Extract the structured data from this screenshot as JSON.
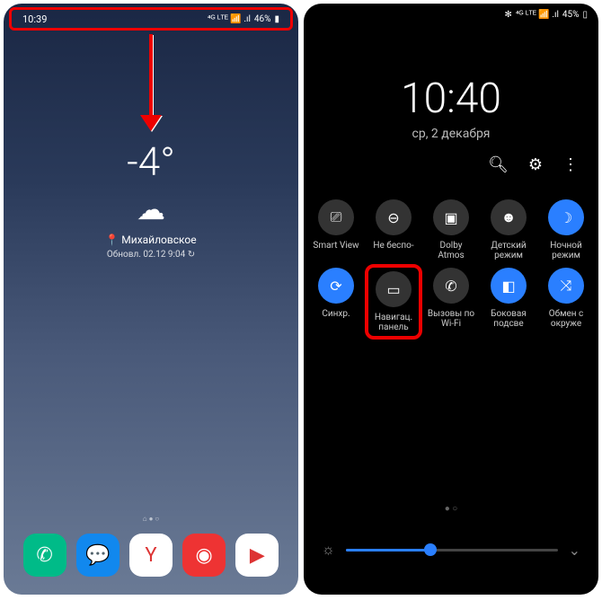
{
  "left": {
    "status": {
      "time": "10:39",
      "battery": "46%",
      "icons": "⁴ᴳ ᴸᵀᴱ 📶 .ıl"
    },
    "weather": {
      "temp": "-4°",
      "location": "Михайловское",
      "updated": "Обновл. 02.12 9:04 ↻"
    },
    "dock": [
      {
        "name": "phone",
        "glyph": "✆",
        "bg": "#0b8"
      },
      {
        "name": "messages",
        "glyph": "💬",
        "bg": "#18e"
      },
      {
        "name": "yandex",
        "glyph": "Y",
        "bg": "#fff"
      },
      {
        "name": "camera",
        "glyph": "◉",
        "bg": "#e33"
      },
      {
        "name": "play",
        "glyph": "▶",
        "bg": "#fff"
      }
    ]
  },
  "right": {
    "status": {
      "battery": "45%",
      "icons": "⁴ᴳ ᴸᵀᴱ 📶 .ıl"
    },
    "time": "10:40",
    "date": "ср, 2 декабря",
    "tiles": [
      {
        "name": "smart-view",
        "label": "Smart View",
        "glyph": "⎚",
        "active": false
      },
      {
        "name": "no-disturb",
        "label": "Не беспо-",
        "glyph": "⊖",
        "active": false
      },
      {
        "name": "dolby",
        "label": "Dolby Atmos",
        "glyph": "▣",
        "active": false
      },
      {
        "name": "kids",
        "label": "Детский режим",
        "glyph": "☻",
        "active": false
      },
      {
        "name": "night",
        "label": "Ночной режим",
        "glyph": "☽",
        "active": true
      },
      {
        "name": "sync",
        "label": "Синхр.",
        "glyph": "⟳",
        "active": true
      },
      {
        "name": "nav-panel",
        "label": "Навигац. панель",
        "glyph": "▭",
        "active": false,
        "highlight": true
      },
      {
        "name": "wifi-calls",
        "label": "Вызовы по Wi-Fi",
        "glyph": "✆",
        "active": false
      },
      {
        "name": "side-light",
        "label": "Боковая подсве",
        "glyph": "◧",
        "active": true
      },
      {
        "name": "share",
        "label": "Обмен с окруже",
        "glyph": "⤨",
        "active": true
      }
    ]
  }
}
